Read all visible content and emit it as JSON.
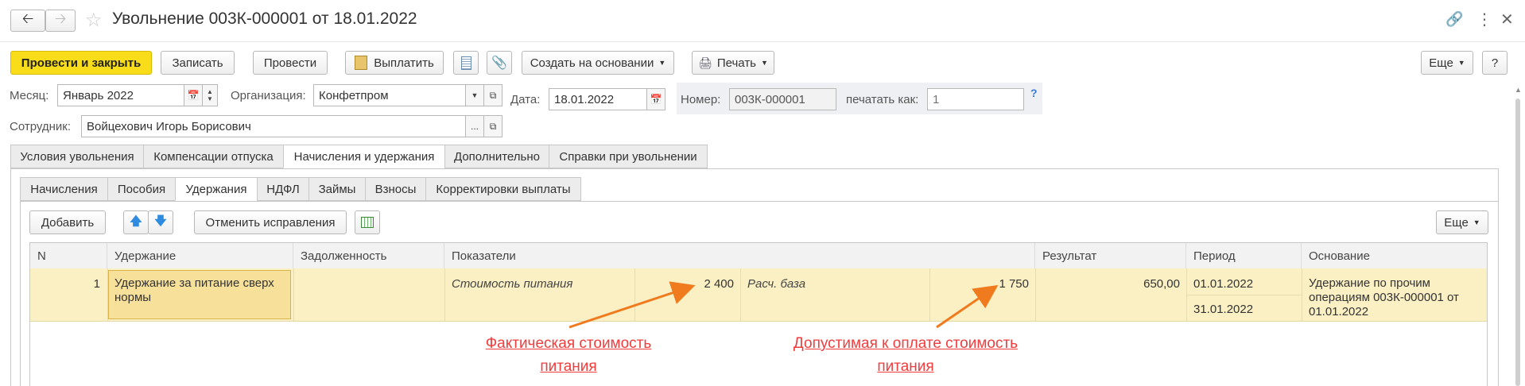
{
  "window": {
    "title": "Увольнение 003К-000001 от 18.01.2022"
  },
  "toolbar": {
    "post_close": "Провести и закрыть",
    "save": "Записать",
    "post": "Провести",
    "pay": "Выплатить",
    "create_based": "Создать на основании",
    "print": "Печать",
    "more": "Еще",
    "help": "?"
  },
  "form": {
    "month_label": "Месяц:",
    "month_value": "Январь 2022",
    "org_label": "Организация:",
    "org_value": "Конфетпром",
    "date_label": "Дата:",
    "date_value": "18.01.2022",
    "number_label": "Номер:",
    "number_value": "003К-000001",
    "print_as_label": "печатать как:",
    "print_as_placeholder": "1",
    "question": "?",
    "employee_label": "Сотрудник:",
    "employee_value": "Войцехович Игорь Борисович",
    "dots": "..."
  },
  "main_tabs": [
    {
      "label": "Условия увольнения"
    },
    {
      "label": "Компенсации отпуска"
    },
    {
      "label": "Начисления и удержания"
    },
    {
      "label": "Дополнительно"
    },
    {
      "label": "Справки при увольнении"
    }
  ],
  "sub_tabs": [
    {
      "label": "Начисления"
    },
    {
      "label": "Пособия"
    },
    {
      "label": "Удержания"
    },
    {
      "label": "НДФЛ"
    },
    {
      "label": "Займы"
    },
    {
      "label": "Взносы"
    },
    {
      "label": "Корректировки выплаты"
    }
  ],
  "table_toolbar": {
    "add": "Добавить",
    "cancel_corrections": "Отменить исправления",
    "more": "Еще"
  },
  "table": {
    "columns": [
      "N",
      "Удержание",
      "Задолженность",
      "Показатели",
      "Результат",
      "Период",
      "Основание"
    ],
    "rows": [
      {
        "n": "1",
        "deduction": "Удержание за питание сверх нормы",
        "debt": "",
        "indicator1_name": "Стоимость питания",
        "indicator1_value": "2 400",
        "indicator2_name": "Расч. база",
        "indicator2_value": "1 750",
        "result": "650,00",
        "period_from": "01.01.2022",
        "period_to": "31.01.2022",
        "basis": "Удержание по прочим операциям 003К-000001 от 01.01.2022"
      }
    ]
  },
  "annotations": {
    "left": "Фактическая стоимость питания",
    "right": "Допустимая к оплате стоимость питания",
    "color": "#f03c3c"
  },
  "icons": [
    "back-icon",
    "forward-icon",
    "star-icon",
    "link-icon",
    "kebab-icon",
    "close-icon",
    "pay-icon",
    "report-icon",
    "paperclip-icon",
    "printer-icon",
    "calendar-icon",
    "spinner-icon",
    "dropdown-icon",
    "open-icon",
    "arrow-up-icon",
    "arrow-down-icon",
    "table-settings-icon"
  ]
}
